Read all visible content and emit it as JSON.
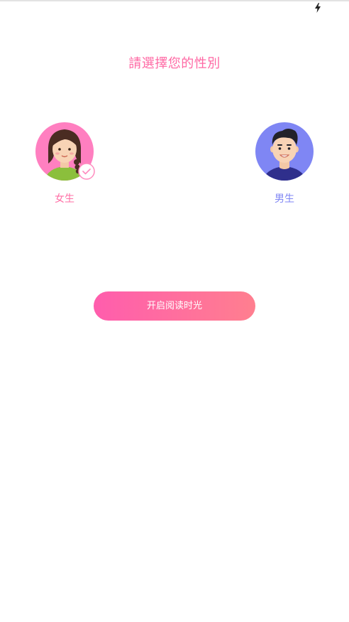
{
  "status_bar": {
    "icon": "charging-bolt-icon"
  },
  "title": "請選擇您的性別",
  "genders": {
    "female": {
      "label": "女生",
      "selected": true,
      "avatar_icon": "female-avatar-icon",
      "check_icon": "checkmark-icon"
    },
    "male": {
      "label": "男生",
      "selected": false,
      "avatar_icon": "male-avatar-icon"
    }
  },
  "start_button": {
    "label": "开启阅读时光"
  },
  "colors": {
    "accent_pink": "#ff69a4",
    "male_blue": "#7f86f4",
    "button_gradient_start": "#ff5dad",
    "button_gradient_end": "#ff7f8f"
  }
}
